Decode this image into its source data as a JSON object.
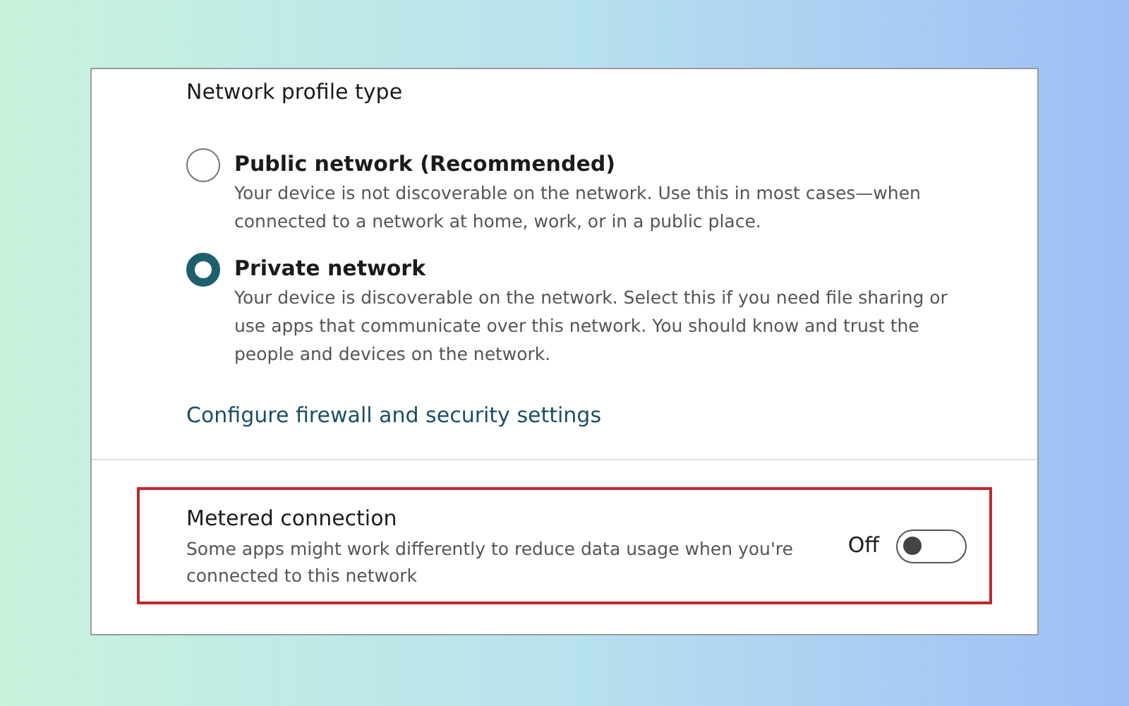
{
  "network_profile": {
    "title": "Network profile type",
    "options": [
      {
        "label": "Public network (Recommended)",
        "description": "Your device is not discoverable on the network. Use this in most cases—when connected to a network at home, work, or in a public place.",
        "selected": false
      },
      {
        "label": "Private network",
        "description": "Your device is discoverable on the network. Select this if you need file sharing or use apps that communicate over this network. You should know and trust the people and devices on the network.",
        "selected": true
      }
    ],
    "link": "Configure firewall and security settings"
  },
  "metered_connection": {
    "title": "Metered connection",
    "description": "Some apps might work differently to reduce data usage when you're connected to this network",
    "state_label": "Off",
    "on": false,
    "highlighted": true
  }
}
